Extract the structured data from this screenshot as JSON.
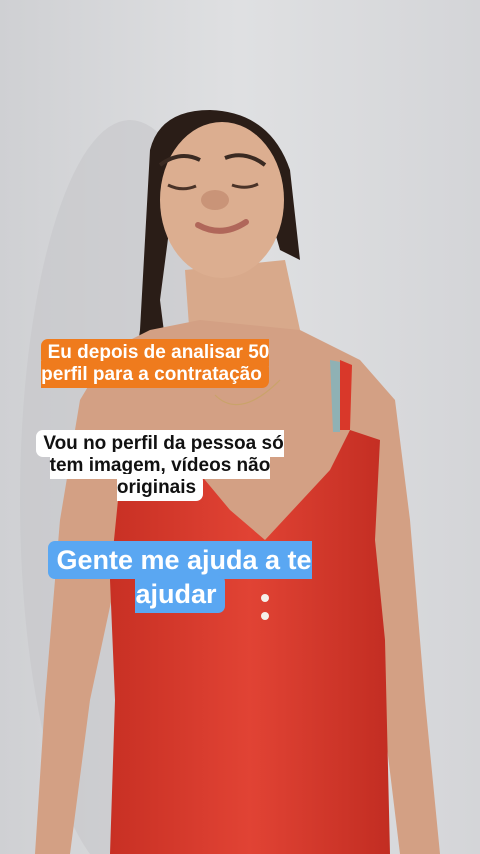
{
  "captions": {
    "first": "Eu depois de analisar 50 perfil para a contratação",
    "second": "Vou no perfil da pessoa só tem imagem, vídeos não originais",
    "third": "Gente me ajuda a te ajudar"
  },
  "colors": {
    "wall": "#d9dadc",
    "top": "#ef7b1d",
    "middle": "#ffffff",
    "bottom": "#5aa7f2",
    "shirt": "#d9382a"
  }
}
